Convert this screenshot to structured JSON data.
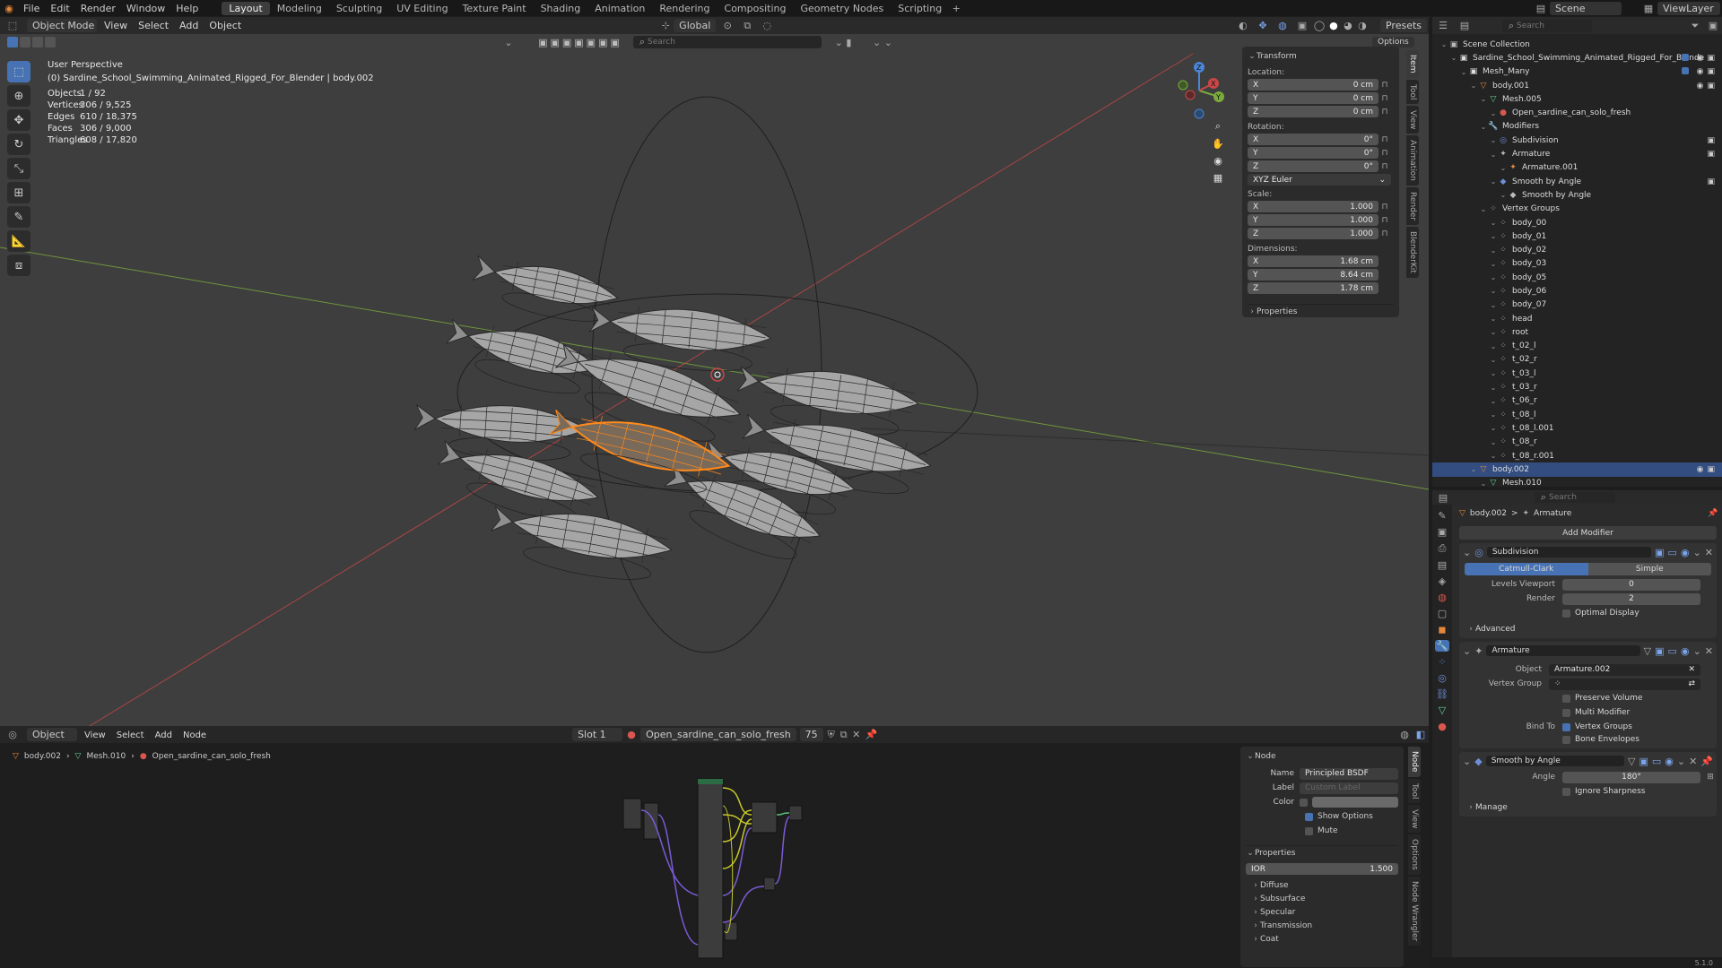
{
  "topbar": {
    "menus": [
      "File",
      "Edit",
      "Render",
      "Window",
      "Help"
    ],
    "workspaces": [
      "Layout",
      "Modeling",
      "Sculpting",
      "UV Editing",
      "Texture Paint",
      "Shading",
      "Animation",
      "Rendering",
      "Compositing",
      "Geometry Nodes",
      "Scripting"
    ],
    "active_workspace": "Layout",
    "scene": "Scene",
    "view_layer": "ViewLayer"
  },
  "viewport_header": {
    "mode": "Object Mode",
    "menus": [
      "View",
      "Select",
      "Add",
      "Object"
    ],
    "orientation": "Global",
    "presets": "Presets",
    "options": "Options",
    "search_placeholder": "Search"
  },
  "viewport": {
    "view_name": "User Perspective",
    "object_path": "(0) Sardine_School_Swimming_Animated_Rigged_For_Blender | body.002",
    "stats": [
      {
        "label": "Objects",
        "value": "1 / 92"
      },
      {
        "label": "Vertices",
        "value": "306 / 9,525"
      },
      {
        "label": "Edges",
        "value": "610 / 18,375"
      },
      {
        "label": "Faces",
        "value": "306 / 9,000"
      },
      {
        "label": "Triangles",
        "value": "608 / 17,820"
      }
    ]
  },
  "transform": {
    "title": "Transform",
    "location_label": "Location:",
    "location": [
      {
        "axis": "X",
        "value": "0 cm"
      },
      {
        "axis": "Y",
        "value": "0 cm"
      },
      {
        "axis": "Z",
        "value": "0 cm"
      }
    ],
    "rotation_label": "Rotation:",
    "rotation": [
      {
        "axis": "X",
        "value": "0°"
      },
      {
        "axis": "Y",
        "value": "0°"
      },
      {
        "axis": "Z",
        "value": "0°"
      }
    ],
    "rotation_mode": "XYZ Euler",
    "scale_label": "Scale:",
    "scale": [
      {
        "axis": "X",
        "value": "1.000"
      },
      {
        "axis": "Y",
        "value": "1.000"
      },
      {
        "axis": "Z",
        "value": "1.000"
      }
    ],
    "dimensions_label": "Dimensions:",
    "dimensions": [
      {
        "axis": "X",
        "value": "1.68 cm"
      },
      {
        "axis": "Y",
        "value": "8.64 cm"
      },
      {
        "axis": "Z",
        "value": "1.78 cm"
      }
    ],
    "properties": "Properties"
  },
  "sidebar_tabs": [
    "Item",
    "Tool",
    "View",
    "Animation",
    "Render",
    "BlenderKit"
  ],
  "outliner": {
    "search_placeholder": "Search",
    "rows": [
      {
        "label": "Scene Collection",
        "level": 0,
        "icon": "▣",
        "color": "#bbb"
      },
      {
        "label": "Sardine_School_Swimming_Animated_Rigged_For_Blende",
        "level": 1,
        "icon": "▣",
        "color": "#ddd"
      },
      {
        "label": "Mesh_Many",
        "level": 2,
        "icon": "▣",
        "color": "#ddd"
      },
      {
        "label": "body.001",
        "level": 3,
        "icon": "▽",
        "color": "#e6883c"
      },
      {
        "label": "Mesh.005",
        "level": 4,
        "icon": "▽",
        "color": "#5fd18f"
      },
      {
        "label": "Open_sardine_can_solo_fresh",
        "level": 5,
        "icon": "●",
        "color": "#d9574f"
      },
      {
        "label": "Modifiers",
        "level": 4,
        "icon": "🔧",
        "color": "#6d8fd6"
      },
      {
        "label": "Subdivision",
        "level": 5,
        "icon": "◎",
        "color": "#6d8fd6"
      },
      {
        "label": "Armature",
        "level": 5,
        "icon": "✦",
        "color": "#bbb"
      },
      {
        "label": "Armature.001",
        "level": 6,
        "icon": "✦",
        "color": "#e6883c"
      },
      {
        "label": "Smooth by Angle",
        "level": 5,
        "icon": "◆",
        "color": "#6d8fd6"
      },
      {
        "label": "Smooth by Angle",
        "level": 6,
        "icon": "◆",
        "color": "#bbb"
      },
      {
        "label": "Vertex Groups",
        "level": 4,
        "icon": "⁘",
        "color": "#bbb"
      },
      {
        "label": "body_00",
        "level": 5,
        "icon": "⁘",
        "color": "#bbb"
      },
      {
        "label": "body_01",
        "level": 5,
        "icon": "⁘",
        "color": "#bbb"
      },
      {
        "label": "body_02",
        "level": 5,
        "icon": "⁘",
        "color": "#bbb"
      },
      {
        "label": "body_03",
        "level": 5,
        "icon": "⁘",
        "color": "#bbb"
      },
      {
        "label": "body_05",
        "level": 5,
        "icon": "⁘",
        "color": "#bbb"
      },
      {
        "label": "body_06",
        "level": 5,
        "icon": "⁘",
        "color": "#bbb"
      },
      {
        "label": "body_07",
        "level": 5,
        "icon": "⁘",
        "color": "#bbb"
      },
      {
        "label": "head",
        "level": 5,
        "icon": "⁘",
        "color": "#bbb"
      },
      {
        "label": "root",
        "level": 5,
        "icon": "⁘",
        "color": "#bbb"
      },
      {
        "label": "t_02_l",
        "level": 5,
        "icon": "⁘",
        "color": "#bbb"
      },
      {
        "label": "t_02_r",
        "level": 5,
        "icon": "⁘",
        "color": "#bbb"
      },
      {
        "label": "t_03_l",
        "level": 5,
        "icon": "⁘",
        "color": "#bbb"
      },
      {
        "label": "t_03_r",
        "level": 5,
        "icon": "⁘",
        "color": "#bbb"
      },
      {
        "label": "t_06_r",
        "level": 5,
        "icon": "⁘",
        "color": "#bbb"
      },
      {
        "label": "t_08_l",
        "level": 5,
        "icon": "⁘",
        "color": "#bbb"
      },
      {
        "label": "t_08_l.001",
        "level": 5,
        "icon": "⁘",
        "color": "#bbb"
      },
      {
        "label": "t_08_r",
        "level": 5,
        "icon": "⁘",
        "color": "#bbb"
      },
      {
        "label": "t_08_r.001",
        "level": 5,
        "icon": "⁘",
        "color": "#bbb"
      },
      {
        "label": "body.002",
        "level": 3,
        "icon": "▽",
        "color": "#e6883c",
        "selected": true
      },
      {
        "label": "Mesh.010",
        "level": 4,
        "icon": "▽",
        "color": "#5fd18f"
      }
    ]
  },
  "properties": {
    "search_placeholder": "Search",
    "breadcrumb_object": "body.002",
    "breadcrumb_sep": ">",
    "breadcrumb_item": "Armature",
    "add_modifier": "Add Modifier",
    "subdivision": {
      "name": "Subdivision",
      "tab_a": "Catmull-Clark",
      "tab_b": "Simple",
      "levels_viewport_label": "Levels Viewport",
      "levels_viewport": "0",
      "render_label": "Render",
      "render": "2",
      "optimal_display": "Optimal Display",
      "advanced": "Advanced"
    },
    "armature": {
      "name": "Armature",
      "object_label": "Object",
      "object_value": "Armature.002",
      "vertex_group_label": "Vertex Group",
      "preserve_volume": "Preserve Volume",
      "multi_modifier": "Multi Modifier",
      "bind_to_label": "Bind To",
      "vertex_groups": "Vertex Groups",
      "bone_envelopes": "Bone Envelopes"
    },
    "smooth": {
      "name": "Smooth by Angle",
      "angle_label": "Angle",
      "angle": "180°",
      "ignore_sharpness": "Ignore Sharpness",
      "manage": "Manage"
    }
  },
  "node_editor": {
    "type": "Object",
    "menus": [
      "View",
      "Select",
      "Add",
      "Node"
    ],
    "slot": "Slot 1",
    "material": "Open_sardine_can_solo_fresh",
    "users": "75",
    "breadcrumb": [
      "body.002",
      "Mesh.010",
      "Open_sardine_can_solo_fresh"
    ],
    "node_panel_title": "Node",
    "name_label": "Name",
    "name_value": "Principled BSDF",
    "label_label": "Label",
    "label_placeholder": "Custom Label",
    "color_label": "Color",
    "show_options": "Show Options",
    "mute": "Mute",
    "properties_title": "Properties",
    "ior_label": "IOR",
    "ior_value": "1.500",
    "sections": [
      "Diffuse",
      "Subsurface",
      "Specular",
      "Transmission",
      "Coat"
    ],
    "tabs": [
      "Node",
      "Tool",
      "View",
      "Options",
      "Node Wrangler"
    ]
  },
  "status": {
    "version": "5.1.0"
  },
  "colors": {
    "accent": "#4772b3",
    "selection": "#ff8a1a",
    "x_axis": "#c94747",
    "y_axis": "#7bab3c",
    "z_axis": "#4a85d6"
  }
}
